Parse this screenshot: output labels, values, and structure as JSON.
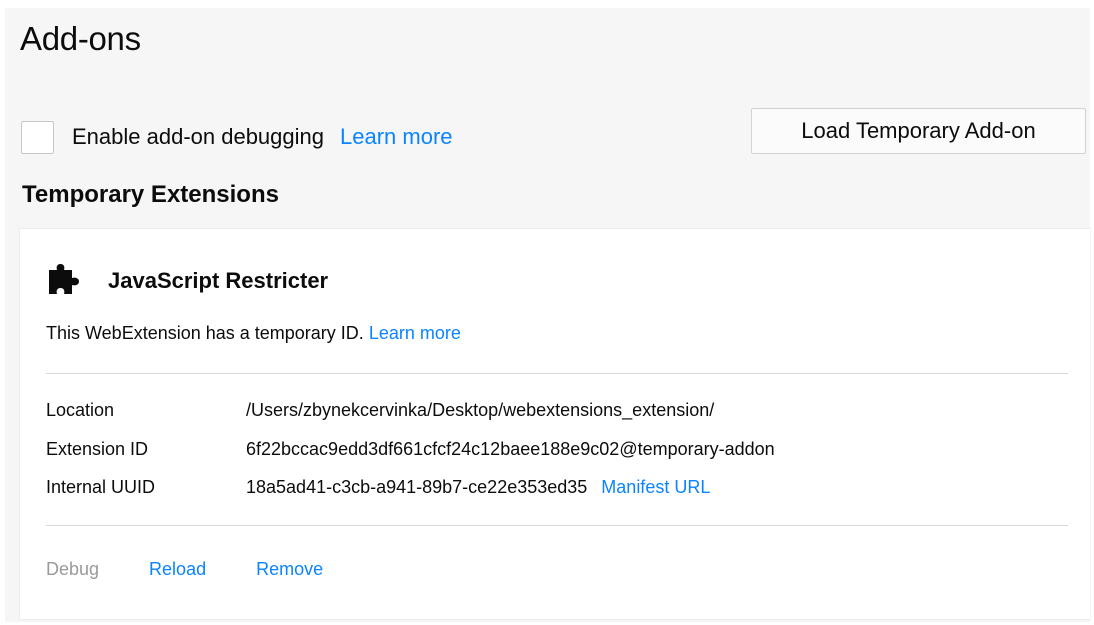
{
  "page": {
    "title": "Add-ons"
  },
  "debugging": {
    "checkbox_checked": false,
    "label": "Enable add-on debugging",
    "learn_more": "Learn more"
  },
  "load_button": {
    "label": "Load Temporary Add-on"
  },
  "temporary_extensions": {
    "heading": "Temporary Extensions",
    "extension": {
      "icon": "puzzle-piece-icon",
      "name": "JavaScript Restricter",
      "temp_note": "This WebExtension has a temporary ID.",
      "temp_learn_more": "Learn more",
      "details": [
        {
          "label": "Location",
          "value": "/Users/zbynekcervinka/Desktop/webextensions_extension/"
        },
        {
          "label": "Extension ID",
          "value": "6f22bccac9edd3df661cfcf24c12baee188e9c02@temporary-addon"
        },
        {
          "label": "Internal UUID",
          "value": "18a5ad41-c3cb-a941-89b7-ce22e353ed35"
        }
      ],
      "manifest_link": "Manifest URL",
      "actions": {
        "debug": "Debug",
        "reload": "Reload",
        "remove": "Remove"
      }
    }
  },
  "colors": {
    "link": "#0a84ff",
    "disabled": "#9a9a9d",
    "page_bg": "#f6f6f6",
    "card_bg": "#ffffff"
  }
}
